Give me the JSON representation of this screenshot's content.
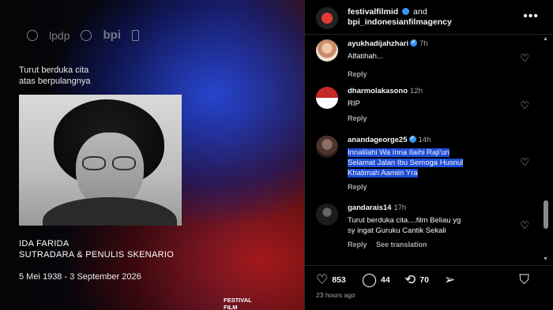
{
  "post": {
    "logos": [
      "lpdp",
      "bpi"
    ],
    "condolence_line1": "Turut berduka cita",
    "condolence_line2": "atas berpulangnya",
    "person_name": "IDA FARIDA",
    "person_role": "SUTRADARA & PENULIS SKENARIO",
    "dates": "5 Mei 1938 - 3 September 2026",
    "festival_line1": "FESTIVAL",
    "festival_line2": "FILM"
  },
  "header": {
    "user1": "festivalfilmid",
    "and": "and",
    "user2": "bpi_indonesianfilmagency",
    "more": "•••"
  },
  "comments": [
    {
      "user": "ayukhadijahzhari",
      "verified": true,
      "time": "7h",
      "text": "Alfatihah...",
      "reply": "Reply"
    },
    {
      "user": "dharmolakasono",
      "verified": false,
      "time": "12h",
      "text": "RIP",
      "reply": "Reply"
    },
    {
      "user": "anandageorge25",
      "verified": true,
      "time": "14h",
      "text_lines": [
        "Innalilahi Wa Inna Ilaihi Raji'un",
        "Selamat Jalan Ibu Semoga Husnul",
        "Khatimah Aamiin Yra"
      ],
      "reply": "Reply"
    },
    {
      "user": "gandarais14",
      "verified": false,
      "time": "17h",
      "text_lines": [
        "Turut berduka cita....film Beliau yg",
        "sy ingat Guruku Cantik Sekali"
      ],
      "reply": "Reply",
      "translate": "See translation"
    }
  ],
  "actions": {
    "likes": "853",
    "comments": "44",
    "reposts": "70"
  },
  "timeago": "23 hours ago",
  "icons": {
    "heart": "heart-icon",
    "comment": "comment-icon",
    "repost": "repost-icon",
    "share": "share-icon",
    "save": "bookmark-icon",
    "more": "more-icon"
  },
  "colors": {
    "selection": "#1f4ed8",
    "verified": "#3897f0",
    "muted": "#a8a8a8"
  }
}
